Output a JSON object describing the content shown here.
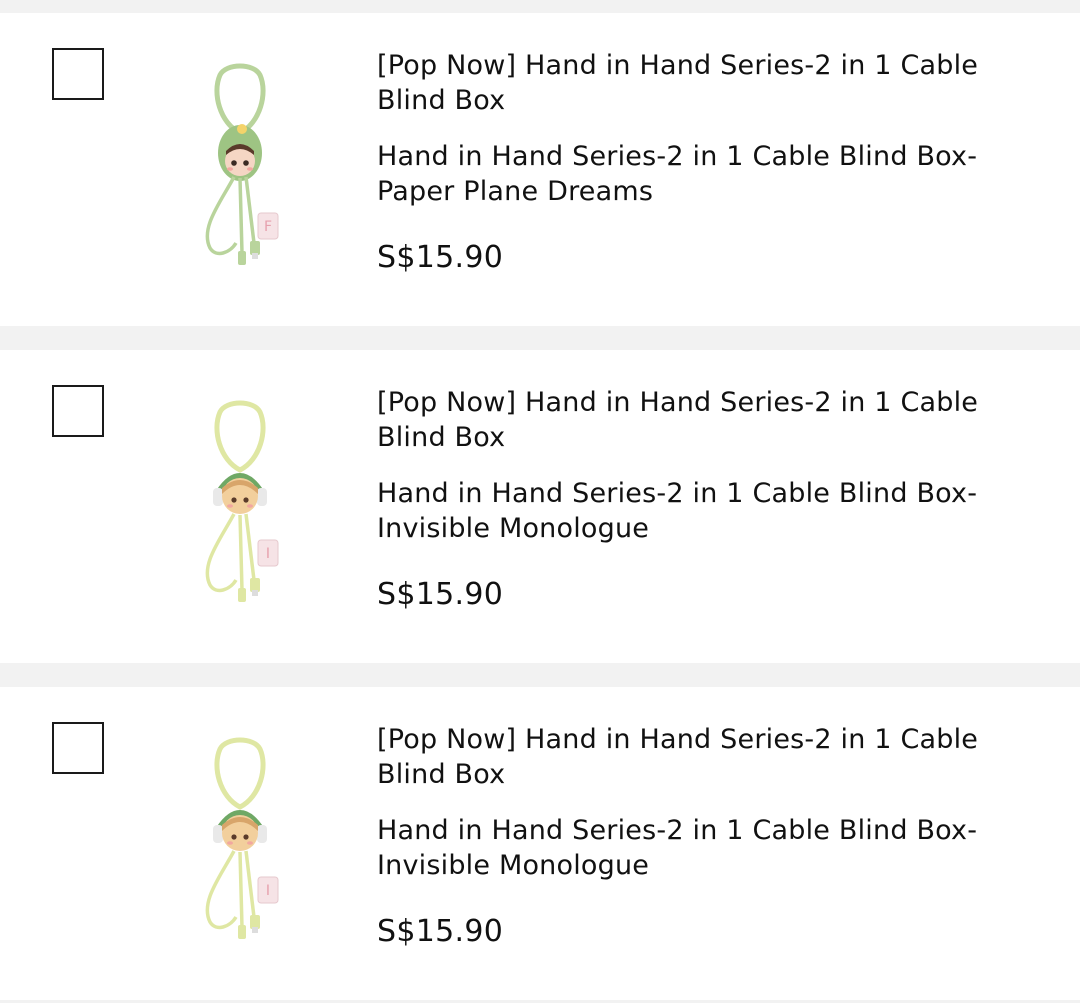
{
  "cart": {
    "items": [
      {
        "title": "[Pop Now] Hand in Hand Series-2 in 1 Cable Blind Box",
        "variant": "Hand in Hand Series-2 in 1 Cable Blind Box-Paper Plane Dreams",
        "price": "S$15.90",
        "checked": false,
        "image": {
          "icon": "figure-cable-keychain-icon",
          "cable_color": "#b9d49c",
          "hood_color": "#9ec483",
          "tag_letter": "F"
        }
      },
      {
        "title": "[Pop Now] Hand in Hand Series-2 in 1 Cable Blind Box",
        "variant": "Hand in Hand Series-2 in 1 Cable Blind Box-Invisible Monologue",
        "price": "S$15.90",
        "checked": false,
        "image": {
          "icon": "figure-cable-keychain-icon",
          "cable_color": "#dfe7a3",
          "hood_color": "#6fa865",
          "tag_letter": "I"
        }
      },
      {
        "title": "[Pop Now] Hand in Hand Series-2 in 1 Cable Blind Box",
        "variant": "Hand in Hand Series-2 in 1 Cable Blind Box-Invisible Monologue",
        "price": "S$15.90",
        "checked": false,
        "image": {
          "icon": "figure-cable-keychain-icon",
          "cable_color": "#dfe7a3",
          "hood_color": "#6fa865",
          "tag_letter": "I"
        }
      }
    ]
  }
}
